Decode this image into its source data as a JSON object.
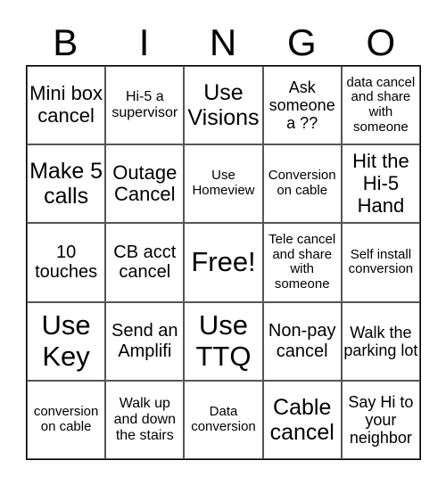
{
  "header": [
    "B",
    "I",
    "N",
    "G",
    "O"
  ],
  "cells": [
    [
      "Mini box cancel",
      "Hi-5 a supervisor",
      "Use Visions",
      "Ask someone a ??",
      "data cancel and share with someone"
    ],
    [
      "Make 5 calls",
      "Outage Cancel",
      "Use Homeview",
      "Conversion on cable",
      "Hit the Hi-5 Hand"
    ],
    [
      "10 touches",
      "CB acct cancel",
      "Free!",
      "Tele cancel and share with someone",
      "Self install conversion"
    ],
    [
      "Use Key",
      "Send an Amplifi",
      "Use TTQ",
      "Non-pay cancel",
      "Walk the parking lot"
    ],
    [
      "conversion on cable",
      "Walk up and down the stairs",
      "Data conversion",
      "Cable cancel",
      "Say Hi to your neighbor"
    ]
  ]
}
